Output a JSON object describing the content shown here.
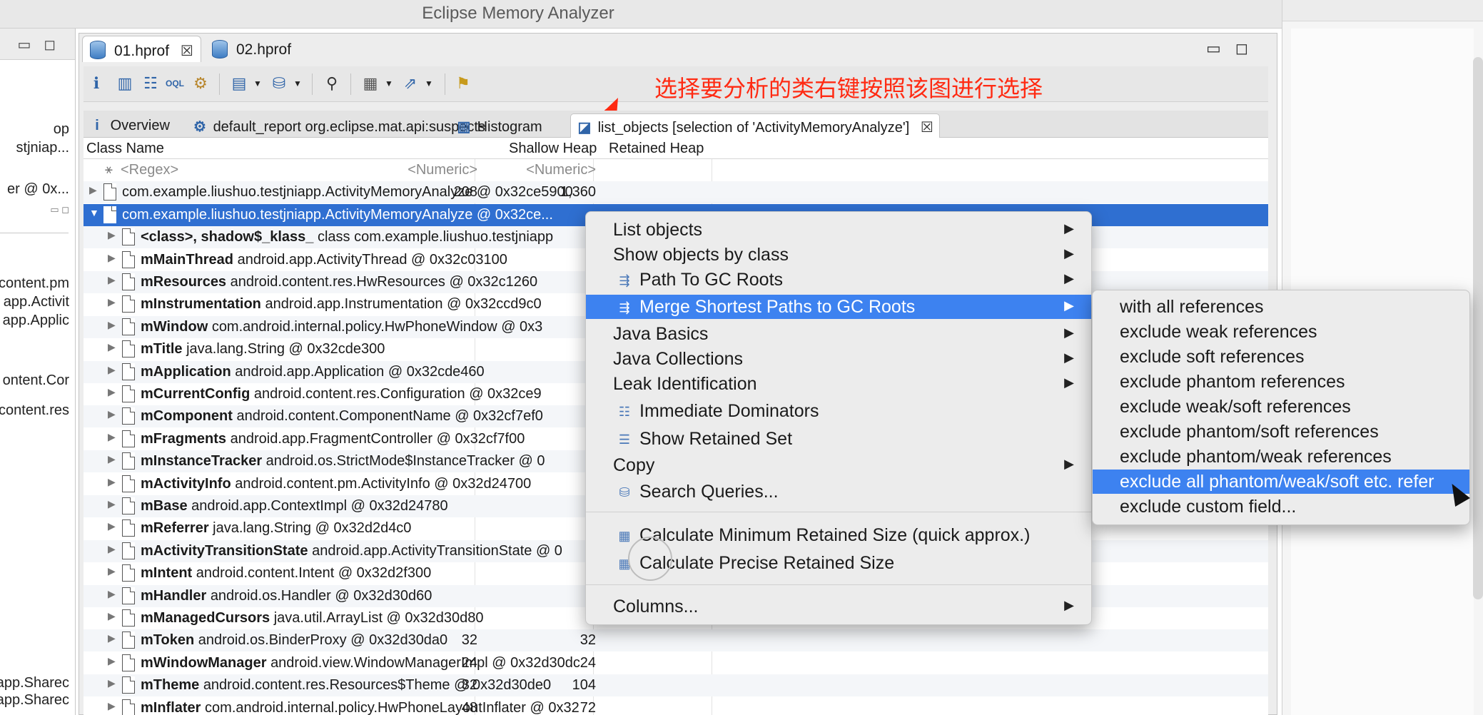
{
  "window": {
    "title": "Eclipse Memory Analyzer"
  },
  "left_panel": {
    "texts": [
      "op",
      "stjniap...",
      "er @ 0x...",
      "content.pm",
      "app.Activit",
      "app.Applic",
      "ontent.Cor",
      "content.res",
      "app.Sharec",
      "app.Sharec"
    ]
  },
  "file_tabs": [
    {
      "label": "01.hprof",
      "icon": "database-icon",
      "active": true,
      "close": "☒"
    },
    {
      "label": "02.hprof",
      "icon": "database-icon",
      "active": false
    }
  ],
  "editor_window_controls": {
    "minimize": "▭",
    "maximize": "◻"
  },
  "annotation": {
    "text": "选择要分析的类右键按照该图进行选择",
    "color": "#ff2a12"
  },
  "toolbar": {
    "icons": [
      "info-icon",
      "histogram-icon",
      "dominator-tree-icon",
      "oql-icon",
      "gear-icon",
      "report-dropdown-icon",
      "query-dropdown-icon",
      "search-icon",
      "calculator-dropdown-icon",
      "export-dropdown-icon",
      "heap-dump-icon"
    ]
  },
  "sub_tabs": [
    {
      "label": "Overview",
      "icon": "i"
    },
    {
      "label": "default_report  org.eclipse.mat.api:suspects",
      "icon": "⚙"
    },
    {
      "label": "Histogram",
      "icon": "▥"
    },
    {
      "label": "list_objects [selection of 'ActivityMemoryAnalyze']",
      "icon": "◪",
      "active": true,
      "close": "☒"
    }
  ],
  "table": {
    "columns": [
      "Class Name",
      "Shallow Heap",
      "Retained Heap"
    ],
    "filter_row": {
      "name": "<Regex>",
      "shallow": "<Numeric>",
      "retained": "<Numeric>"
    },
    "rows": [
      {
        "name": "com.example.liushuo.testjniapp.ActivityMemoryAnalyze @ 0x32ce5900",
        "shallow": "208",
        "retained": "1,360",
        "level": 0,
        "selected": false
      },
      {
        "name": "com.example.liushuo.testjniapp.ActivityMemoryAnalyze @ 0x32ce...",
        "shallow": "",
        "retained": "",
        "level": 0,
        "selected": true,
        "expanded": true
      },
      {
        "field": "<class>, shadow$_klass_",
        "value": "class com.example.liushuo.testjniapp",
        "shallow": "",
        "retained": "",
        "level": 1
      },
      {
        "field": "mMainThread",
        "value": "android.app.ActivityThread @ 0x32c03100",
        "shallow": "",
        "retained": "",
        "level": 1
      },
      {
        "field": "mResources",
        "value": "android.content.res.HwResources @ 0x32c1260",
        "shallow": "",
        "retained": "",
        "level": 1
      },
      {
        "field": "mInstrumentation",
        "value": "android.app.Instrumentation @ 0x32ccd9c0",
        "shallow": "",
        "retained": "",
        "level": 1
      },
      {
        "field": "mWindow",
        "value": "com.android.internal.policy.HwPhoneWindow @ 0x3",
        "shallow": "",
        "retained": "",
        "level": 1
      },
      {
        "field": "mTitle",
        "value": "java.lang.String @ 0x32cde300",
        "shallow": "",
        "retained": "",
        "level": 1
      },
      {
        "field": "mApplication",
        "value": "android.app.Application @ 0x32cde460",
        "shallow": "",
        "retained": "",
        "level": 1
      },
      {
        "field": "mCurrentConfig",
        "value": "android.content.res.Configuration @ 0x32ce9",
        "shallow": "",
        "retained": "",
        "level": 1
      },
      {
        "field": "mComponent",
        "value": "android.content.ComponentName @ 0x32cf7ef0",
        "shallow": "",
        "retained": "",
        "level": 1
      },
      {
        "field": "mFragments",
        "value": "android.app.FragmentController @ 0x32cf7f00",
        "shallow": "",
        "retained": "",
        "level": 1
      },
      {
        "field": "mInstanceTracker",
        "value": "android.os.StrictMode$InstanceTracker @ 0",
        "shallow": "",
        "retained": "",
        "level": 1
      },
      {
        "field": "mActivityInfo",
        "value": "android.content.pm.ActivityInfo @ 0x32d24700",
        "shallow": "",
        "retained": "",
        "level": 1
      },
      {
        "field": "mBase",
        "value": "android.app.ContextImpl @ 0x32d24780",
        "shallow": "",
        "retained": "",
        "level": 1
      },
      {
        "field": "mReferrer",
        "value": "java.lang.String @ 0x32d2d4c0",
        "shallow": "",
        "retained": "",
        "level": 1
      },
      {
        "field": "mActivityTransitionState",
        "value": "android.app.ActivityTransitionState @ 0",
        "shallow": "",
        "retained": "",
        "level": 1
      },
      {
        "field": "mIntent",
        "value": "android.content.Intent @ 0x32d2f300",
        "shallow": "",
        "retained": "",
        "level": 1
      },
      {
        "field": "mHandler",
        "value": "android.os.Handler @ 0x32d30d60",
        "shallow": "",
        "retained": "",
        "level": 1
      },
      {
        "field": "mManagedCursors",
        "value": "java.util.ArrayList @ 0x32d30d80",
        "shallow": "",
        "retained": "",
        "level": 1
      },
      {
        "field": "mToken",
        "value": "android.os.BinderProxy @ 0x32d30da0",
        "shallow": "32",
        "retained": "32",
        "level": 1
      },
      {
        "field": "mWindowManager",
        "value": "android.view.WindowManagerImpl @ 0x32d30dc",
        "shallow": "24",
        "retained": "24",
        "level": 1
      },
      {
        "field": "mTheme",
        "value": "android.content.res.Resources$Theme @ 0x32d30de0",
        "shallow": "32",
        "retained": "104",
        "level": 1
      },
      {
        "field": "mInflater",
        "value": "com.android.internal.policy.HwPhoneLayoutInflater @ 0x32",
        "shallow": "48",
        "retained": "72",
        "level": 1
      }
    ]
  },
  "context_menu": {
    "items": [
      {
        "label": "List objects",
        "submenu": true
      },
      {
        "label": "Show objects by class",
        "submenu": true
      },
      {
        "label": "Path To GC Roots",
        "submenu": true,
        "icon": "path-icon"
      },
      {
        "label": "Merge Shortest Paths to GC Roots",
        "submenu": true,
        "icon": "merge-paths-icon",
        "highlighted": true
      },
      {
        "label": "Java Basics",
        "submenu": true
      },
      {
        "label": "Java Collections",
        "submenu": true
      },
      {
        "label": "Leak Identification",
        "submenu": true
      },
      {
        "label": "Immediate Dominators",
        "icon": "dominators-icon"
      },
      {
        "label": "Show Retained Set",
        "icon": "retained-set-icon"
      },
      {
        "label": "Copy",
        "submenu": true
      },
      {
        "label": "Search Queries...",
        "icon": "search-queries-icon"
      },
      {
        "label": "Calculate Minimum Retained Size (quick approx.)",
        "icon": "calculator-icon"
      },
      {
        "label": "Calculate Precise Retained Size",
        "icon": "calculator-icon"
      },
      {
        "label": "Columns...",
        "submenu": true
      }
    ],
    "arrow": "▶"
  },
  "submenu": {
    "items": [
      {
        "label": "with all references"
      },
      {
        "label": "exclude weak references"
      },
      {
        "label": "exclude soft references"
      },
      {
        "label": "exclude phantom references"
      },
      {
        "label": "exclude weak/soft references"
      },
      {
        "label": "exclude phantom/soft references"
      },
      {
        "label": "exclude phantom/weak references"
      },
      {
        "label": "exclude all phantom/weak/soft etc. refer",
        "highlighted": true
      },
      {
        "label": "exclude custom field..."
      }
    ]
  },
  "colors": {
    "selection": "#2f6fd1",
    "menu_highlight": "#3d82f0"
  }
}
